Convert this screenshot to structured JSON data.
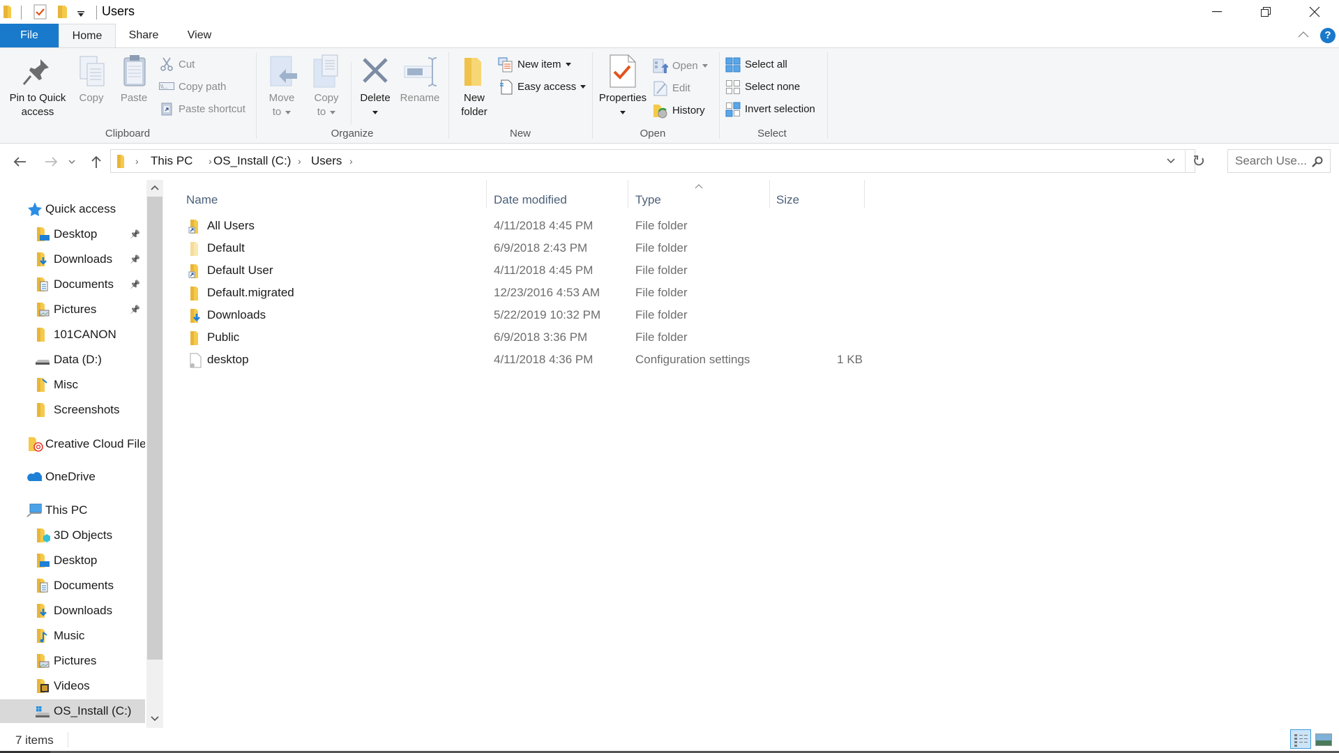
{
  "window": {
    "title": "Users",
    "controls": {
      "minimize": "minimize-icon",
      "restore": "restore-icon",
      "close": "close-icon"
    }
  },
  "ribbon_tabs": [
    {
      "label": "File"
    },
    {
      "label": "Home",
      "active": true
    },
    {
      "label": "Share"
    },
    {
      "label": "View"
    }
  ],
  "ribbon": {
    "clipboard": {
      "label": "Clipboard",
      "pin": "Pin to Quick access",
      "pin_l1": "Pin to Quick",
      "pin_l2": "access",
      "copy": "Copy",
      "paste": "Paste",
      "cut": "Cut",
      "copy_path": "Copy path",
      "paste_shortcut": "Paste shortcut"
    },
    "organize": {
      "label": "Organize",
      "move_l1": "Move",
      "move_l2": "to",
      "copy_l1": "Copy",
      "copy_l2": "to",
      "delete": "Delete",
      "rename": "Rename"
    },
    "new": {
      "label": "New",
      "folder_l1": "New",
      "folder_l2": "folder",
      "new_item": "New item",
      "easy_access": "Easy access"
    },
    "open": {
      "label": "Open",
      "properties": "Properties",
      "open": "Open",
      "edit": "Edit",
      "history": "History"
    },
    "select": {
      "label": "Select",
      "select_all": "Select all",
      "select_none": "Select none",
      "invert": "Invert selection"
    }
  },
  "address": {
    "crumbs": [
      "This PC",
      "OS_Install (C:)",
      "Users"
    ],
    "search_placeholder": "Search Use..."
  },
  "sidebar": {
    "quick_access": "Quick access",
    "quick_items": [
      {
        "label": "Desktop",
        "pinned": true
      },
      {
        "label": "Downloads",
        "pinned": true
      },
      {
        "label": "Documents",
        "pinned": true
      },
      {
        "label": "Pictures",
        "pinned": true
      },
      {
        "label": "101CANON"
      },
      {
        "label": "Data (D:)"
      },
      {
        "label": "Misc"
      },
      {
        "label": "Screenshots"
      }
    ],
    "creative_cloud": "Creative Cloud Files",
    "onedrive": "OneDrive",
    "this_pc": "This PC",
    "pc_items": [
      {
        "label": "3D Objects"
      },
      {
        "label": "Desktop"
      },
      {
        "label": "Documents"
      },
      {
        "label": "Downloads"
      },
      {
        "label": "Music"
      },
      {
        "label": "Pictures"
      },
      {
        "label": "Videos"
      },
      {
        "label": "OS_Install (C:)",
        "selected": true
      }
    ]
  },
  "columns": {
    "name": "Name",
    "date": "Date modified",
    "type": "Type",
    "size": "Size"
  },
  "files": [
    {
      "name": "All Users",
      "date": "4/11/2018 4:45 PM",
      "type": "File folder",
      "size": "",
      "icon": "folder-shortcut"
    },
    {
      "name": "Default",
      "date": "6/9/2018 2:43 PM",
      "type": "File folder",
      "size": "",
      "icon": "folder-hidden"
    },
    {
      "name": "Default User",
      "date": "4/11/2018 4:45 PM",
      "type": "File folder",
      "size": "",
      "icon": "folder-shortcut"
    },
    {
      "name": "Default.migrated",
      "date": "12/23/2016 4:53 AM",
      "type": "File folder",
      "size": "",
      "icon": "folder"
    },
    {
      "name": "Downloads",
      "date": "5/22/2019 10:32 PM",
      "type": "File folder",
      "size": "",
      "icon": "folder-downloads"
    },
    {
      "name": "Public",
      "date": "6/9/2018 3:36 PM",
      "type": "File folder",
      "size": "",
      "icon": "folder"
    },
    {
      "name": "desktop",
      "date": "4/11/2018 4:36 PM",
      "type": "Configuration settings",
      "size": "1 KB",
      "icon": "config-file"
    }
  ],
  "status": {
    "item_count": "7 items"
  },
  "colors": {
    "accent": "#1979ca",
    "folder": "#f5c94a",
    "selected_nav": "#d9d9d9"
  }
}
